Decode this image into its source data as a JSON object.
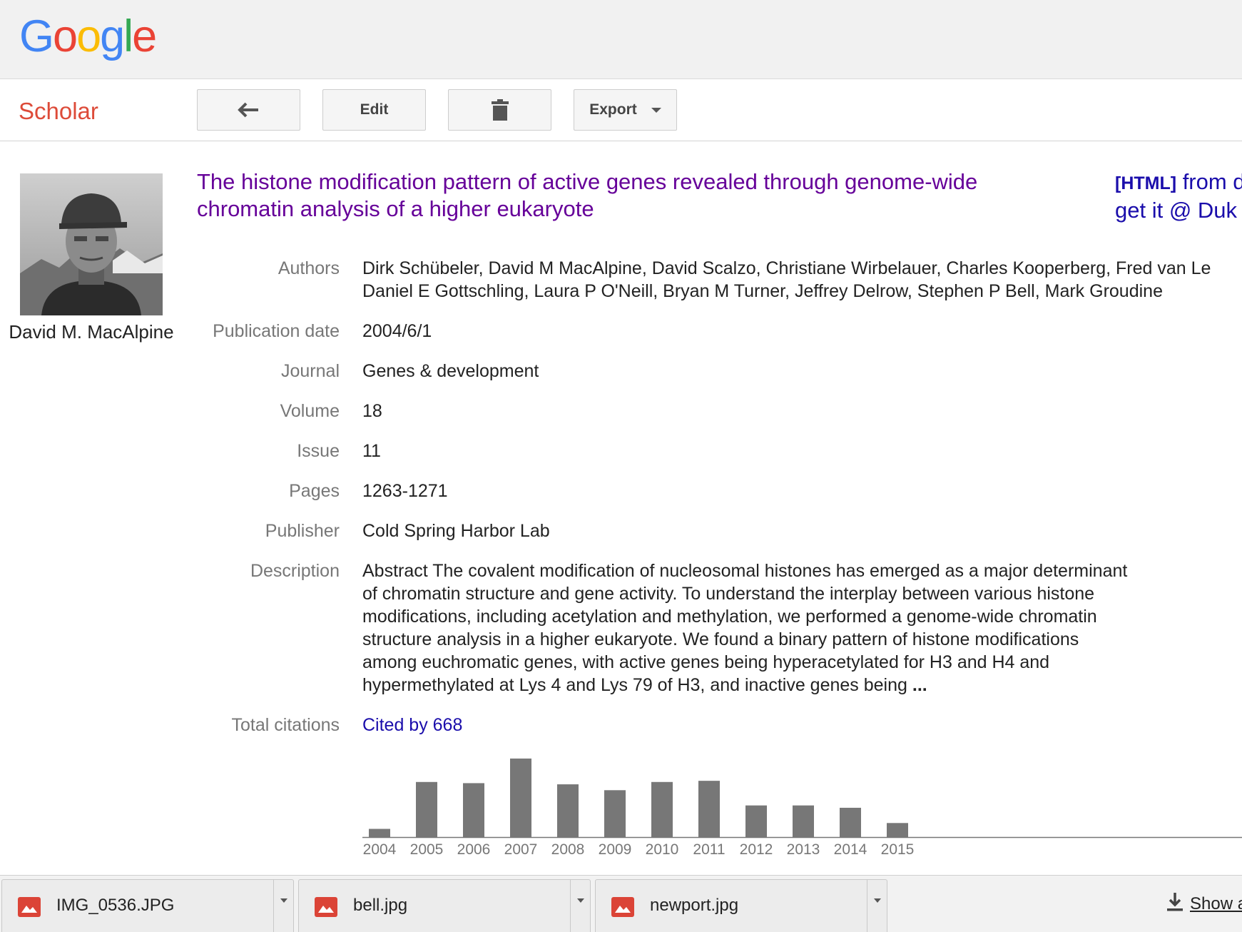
{
  "logo": {
    "letters": [
      "G",
      "o",
      "o",
      "g",
      "l",
      "e"
    ],
    "colors": [
      "#4285f4",
      "#ea4335",
      "#fbbc05",
      "#4285f4",
      "#34a853",
      "#ea4335"
    ]
  },
  "toolbar": {
    "brand": "Scholar",
    "back_icon": "back-arrow-icon",
    "edit_label": "Edit",
    "delete_icon": "trash-icon",
    "export_label": "Export"
  },
  "profile": {
    "name": "David M. MacAlpine"
  },
  "article": {
    "title": "The histone modification pattern of active genes revealed through genome-wide chromatin analysis of a higher eukaryote",
    "fulltext_tag": "[HTML]",
    "fulltext_line1": " from d",
    "fulltext_line2": "get it @ Duk"
  },
  "fields": {
    "authors_label": "Authors",
    "authors": "Dirk Schübeler, David M MacAlpine, David Scalzo, Christiane Wirbelauer, Charles Kooperberg, Fred van Le Daniel E Gottschling, Laura P O'Neill, Bryan M Turner, Jeffrey Delrow, Stephen P Bell, Mark Groudine",
    "pubdate_label": "Publication date",
    "pubdate": "2004/6/1",
    "journal_label": "Journal",
    "journal": "Genes & development",
    "volume_label": "Volume",
    "volume": "18",
    "issue_label": "Issue",
    "issue": "11",
    "pages_label": "Pages",
    "pages": "1263-1271",
    "publisher_label": "Publisher",
    "publisher": "Cold Spring Harbor Lab",
    "description_label": "Description",
    "description": "Abstract The covalent modification of nucleosomal histones has emerged as a major determinant of chromatin structure and gene activity. To understand the interplay between various histone modifications, including acetylation and methylation, we performed a genome-wide chromatin structure analysis in a higher eukaryote. We found a binary pattern of histone modifications among euchromatic genes, with active genes being hyperacetylated for H3 and H4 and hypermethylated at Lys 4 and Lys 79 of H3, and inactive genes being",
    "description_more": "...",
    "citations_label": "Total citations",
    "citations": "Cited by 668"
  },
  "chart_data": {
    "type": "bar",
    "categories": [
      "2004",
      "2005",
      "2006",
      "2007",
      "2008",
      "2009",
      "2010",
      "2011",
      "2012",
      "2013",
      "2014",
      "2015"
    ],
    "values": [
      7,
      47,
      46,
      67,
      45,
      40,
      47,
      48,
      27,
      27,
      25,
      12
    ],
    "ylim": [
      0,
      70
    ],
    "bar_color": "#777777",
    "grid": false
  },
  "downloads": {
    "items": [
      {
        "name": "IMG_0536.JPG",
        "icon": "image-file-icon"
      },
      {
        "name": "bell.jpg",
        "icon": "image-file-icon"
      },
      {
        "name": "newport.jpg",
        "icon": "image-file-icon"
      }
    ],
    "show_all": "Show a",
    "show_all_icon": "download-icon"
  }
}
